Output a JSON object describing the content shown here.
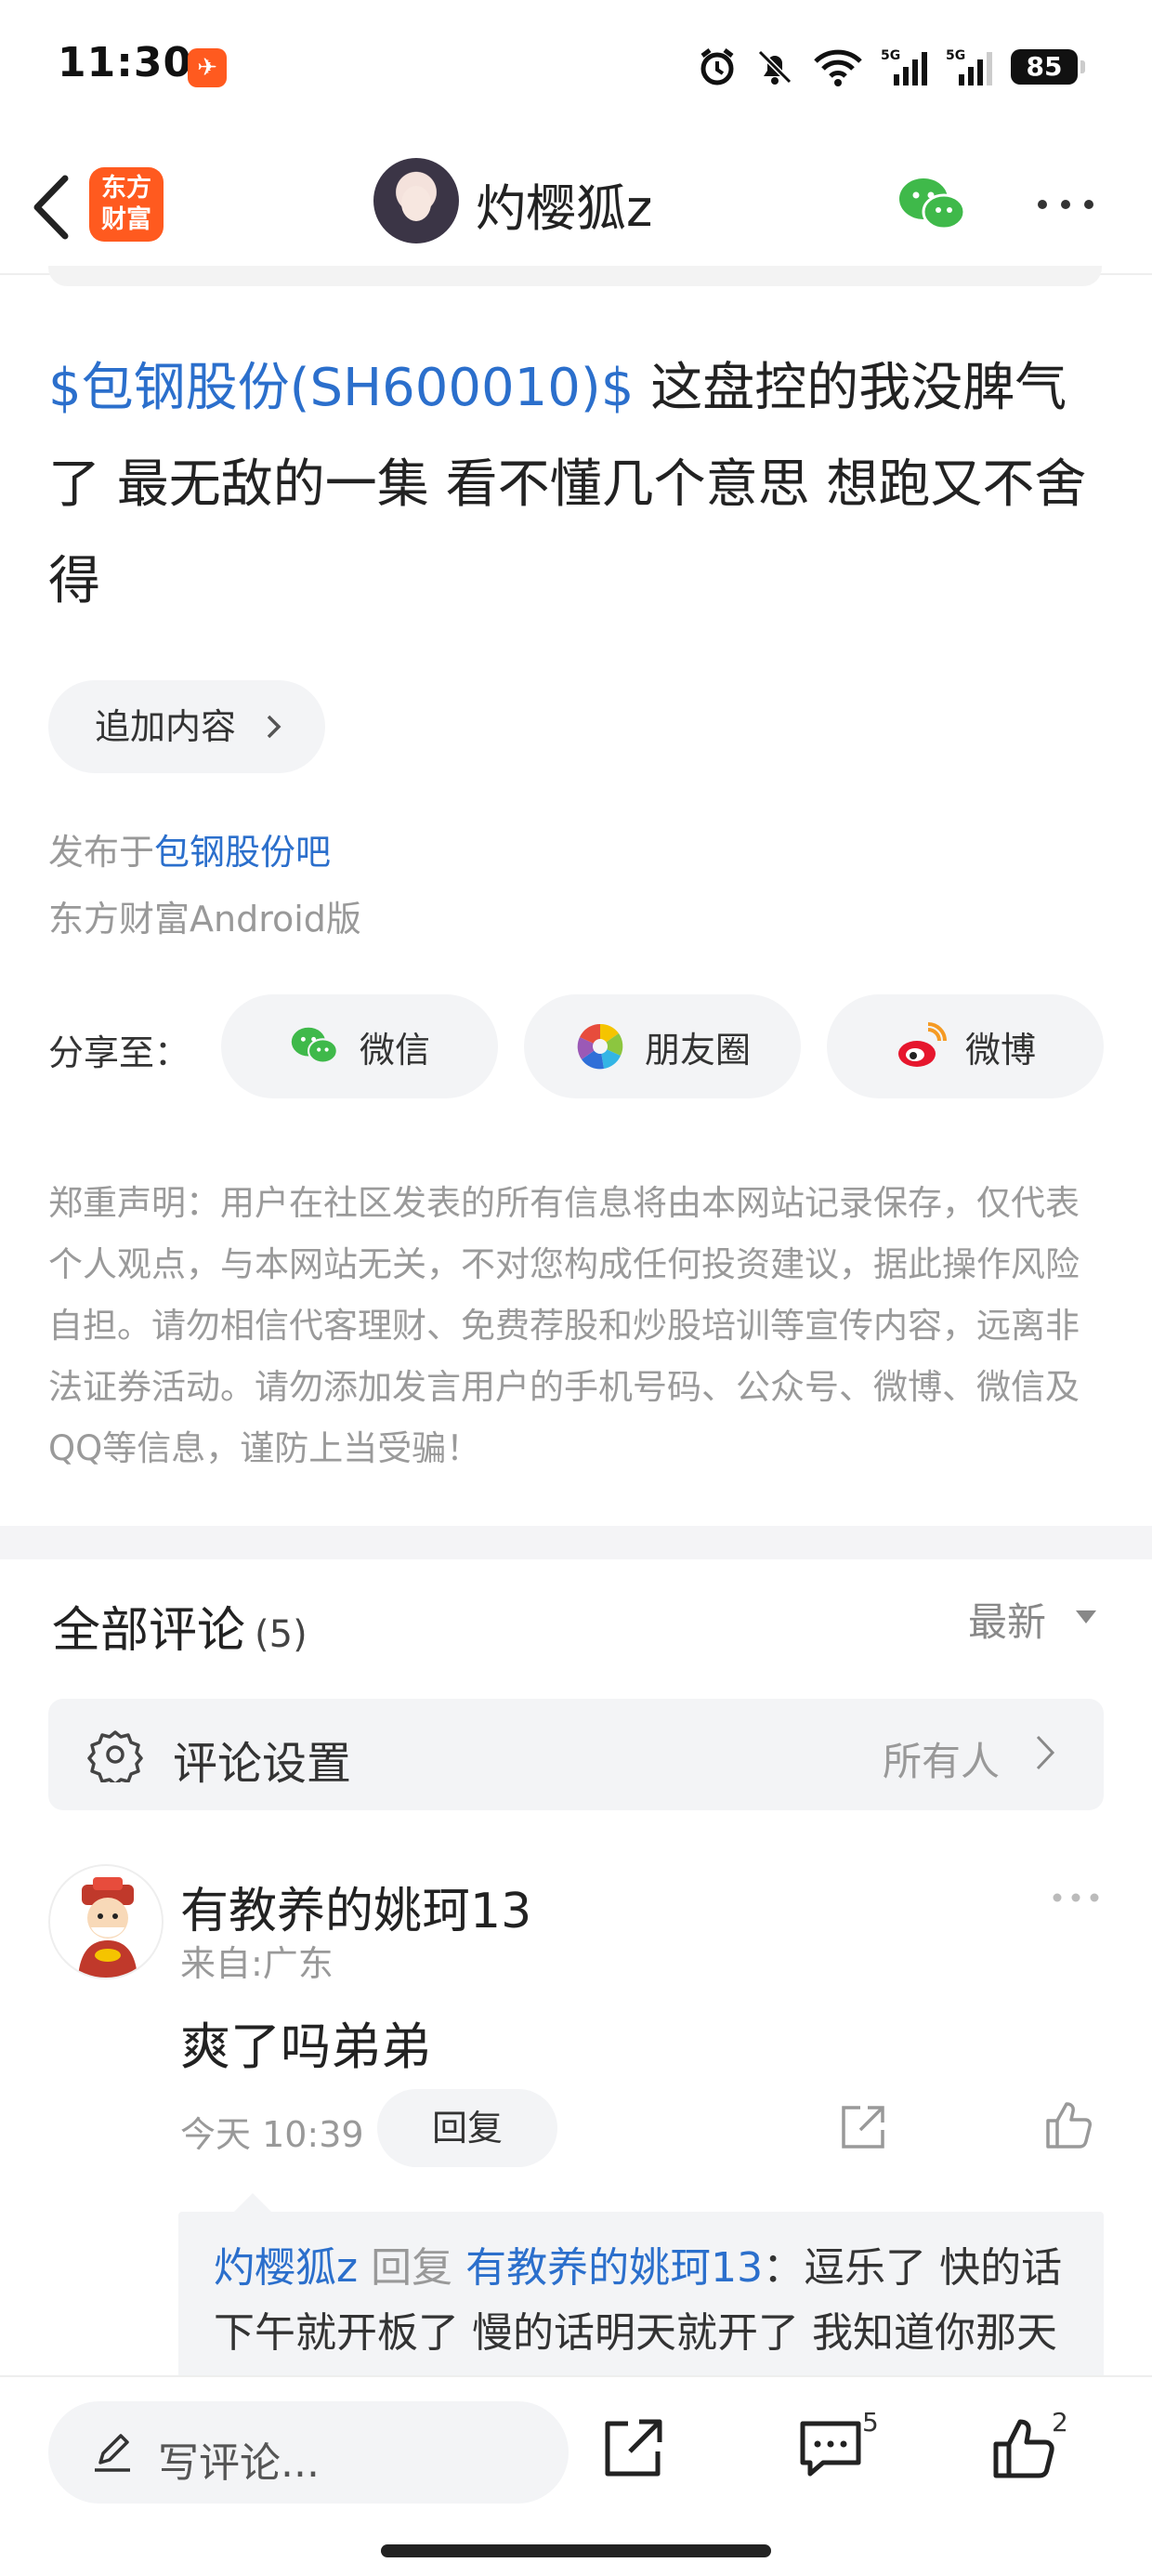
{
  "status_bar": {
    "time": "11:30",
    "battery": "85",
    "signal_label_1": "5G",
    "signal_label_2": "5G"
  },
  "header": {
    "app_logo_text": "东方财富",
    "username": "灼樱狐z"
  },
  "post": {
    "stock_link": "$包钢股份(SH600010)$",
    "text": " 这盘控的我没脾气了 最无敌的一集 看不懂几个意思 想跑又不舍得",
    "append_label": "追加内容",
    "published_prefix": "发布于",
    "published_bar": "包钢股份吧",
    "client": "东方财富Android版"
  },
  "share": {
    "label": "分享至：",
    "wechat": "微信",
    "moments": "朋友圈",
    "weibo": "微博"
  },
  "disclaimer": "郑重声明：用户在社区发表的所有信息将由本网站记录保存，仅代表个人观点，与本网站无关，不对您构成任何投资建议，据此操作风险自担。请勿相信代客理财、免费荐股和炒股培训等宣传内容，远离非法证券活动。请勿添加发言用户的手机号码、公众号、微博、微信及QQ等信息，谨防上当受骗！",
  "comments": {
    "title": "全部评论",
    "count": "(5)",
    "sort": "最新",
    "settings_label": "评论设置",
    "settings_value": "所有人",
    "items": [
      {
        "user": "有教养的姚珂13",
        "location": "来自:广东",
        "text": "爽了吗弟弟",
        "time": "今天 10:39",
        "reply_label": "回复",
        "reply": {
          "from": "灼樱狐z",
          "keyword": "回复",
          "to": "有教养的姚珂13",
          "text": "：逗乐了 快的话下午就开板了 慢的话明天就开了 我知道你那天"
        }
      }
    ]
  },
  "bottom_bar": {
    "write_placeholder": "写评论...",
    "comment_count": "5",
    "like_count": "2"
  },
  "colors": {
    "link_blue": "#2b6fcc",
    "brand_orange": "#ff5a1f",
    "wechat_green": "#3fb94a",
    "weibo_red": "#e6162d"
  }
}
